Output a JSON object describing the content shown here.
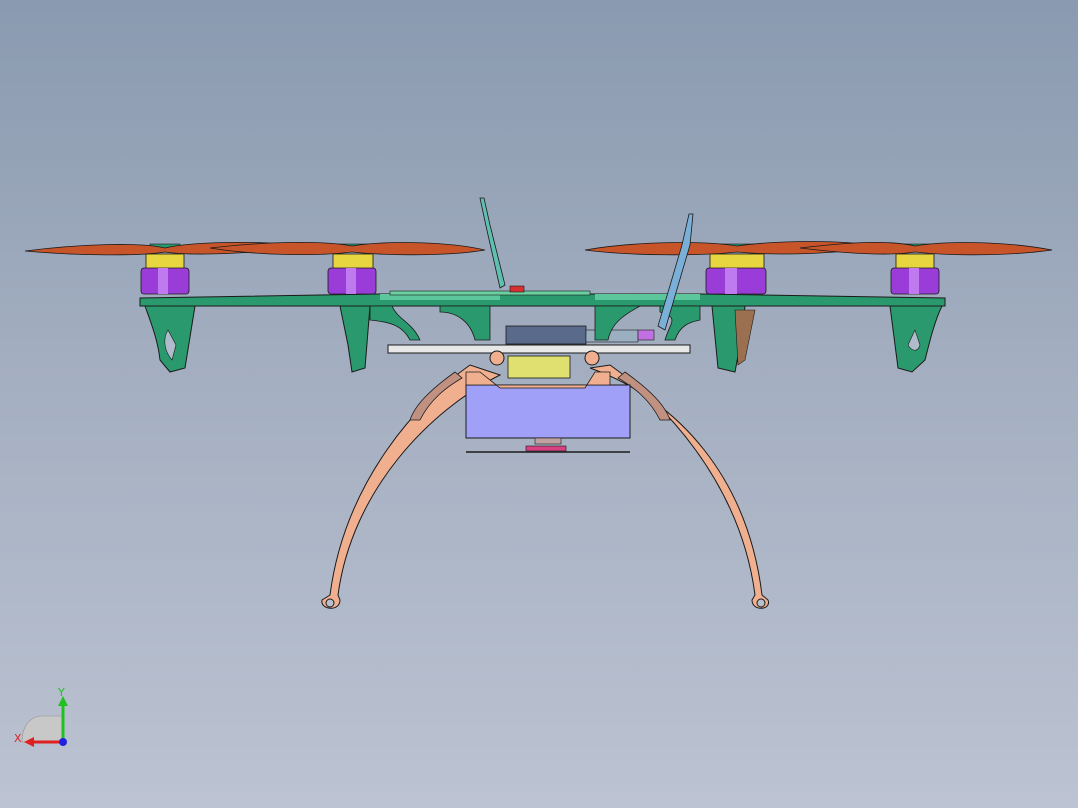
{
  "viewport": {
    "background_top": "#8a9ab0",
    "background_bottom": "#bcc3d2"
  },
  "model": {
    "colors": {
      "frame": "#2a9a6e",
      "frame_light": "#5cc79a",
      "motor_body": "#9a3dd8",
      "motor_cap": "#e8d640",
      "propeller": "#c8552a",
      "landing_gear": "#f0b090",
      "battery": "#a0a0f8",
      "battery_top": "#e0e070",
      "antenna": "#5fbfb0",
      "outline": "#1a1a1a"
    },
    "icons": [
      "quadcopter-model"
    ]
  },
  "triad": {
    "x_label": "X",
    "y_label": "Y",
    "x_color": "#e02020",
    "y_color": "#20c020",
    "z_color": "#2020e0"
  }
}
